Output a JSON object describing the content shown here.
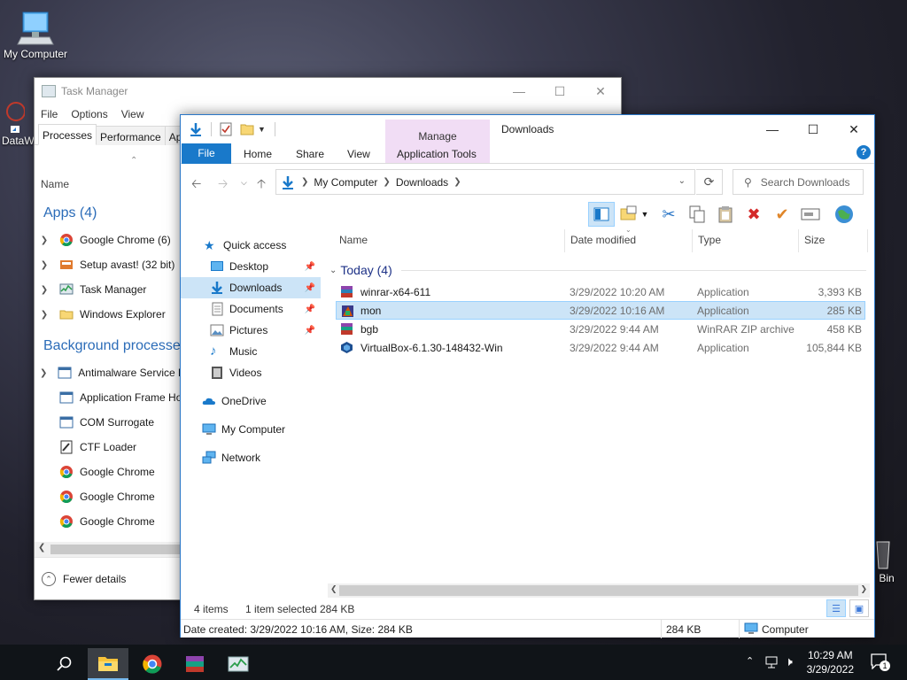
{
  "desktop": {
    "icons": [
      {
        "label": "My Computer"
      },
      {
        "label": "DataW"
      },
      {
        "label": "Bin"
      }
    ]
  },
  "task_manager": {
    "title": "Task Manager",
    "menu": [
      "File",
      "Options",
      "View"
    ],
    "tabs": [
      "Processes",
      "Performance",
      "Ap"
    ],
    "column_name": "Name",
    "apps_section": "Apps (4)",
    "apps": [
      {
        "label": "Google Chrome (6)",
        "icon": "chrome-icon"
      },
      {
        "label": "Setup avast! (32 bit)",
        "icon": "setup-icon"
      },
      {
        "label": "Task Manager",
        "icon": "task-manager-icon"
      },
      {
        "label": "Windows Explorer",
        "icon": "folder-icon"
      }
    ],
    "background_section": "Background processes",
    "background": [
      {
        "label": "Antimalware Service E",
        "icon": "service-icon",
        "expandable": true
      },
      {
        "label": "Application Frame Ho",
        "icon": "service-icon",
        "expandable": false
      },
      {
        "label": "COM Surrogate",
        "icon": "service-icon",
        "expandable": false
      },
      {
        "label": "CTF Loader",
        "icon": "ctf-icon",
        "expandable": false
      },
      {
        "label": "Google Chrome",
        "icon": "chrome-icon",
        "expandable": false
      },
      {
        "label": "Google Chrome",
        "icon": "chrome-icon",
        "expandable": false
      },
      {
        "label": "Google Chrome",
        "icon": "chrome-icon",
        "expandable": false
      }
    ],
    "fewer_details": "Fewer details"
  },
  "explorer": {
    "title": "Downloads",
    "manage_tab": "Manage",
    "ribbon_tabs": {
      "file": "File",
      "home": "Home",
      "share": "Share",
      "view": "View",
      "app_tools": "Application Tools"
    },
    "address": [
      "My Computer",
      "Downloads"
    ],
    "search_placeholder": "Search Downloads",
    "nav": [
      {
        "label": "Quick access",
        "pinned": false,
        "selected": false
      },
      {
        "label": "Desktop",
        "pinned": true,
        "selected": false
      },
      {
        "label": "Downloads",
        "pinned": true,
        "selected": true
      },
      {
        "label": "Documents",
        "pinned": true,
        "selected": false
      },
      {
        "label": "Pictures",
        "pinned": true,
        "selected": false
      },
      {
        "label": "Music",
        "pinned": false,
        "selected": false
      },
      {
        "label": "Videos",
        "pinned": false,
        "selected": false
      },
      {
        "label": "OneDrive",
        "pinned": false,
        "selected": false
      },
      {
        "label": "My Computer",
        "pinned": false,
        "selected": false
      },
      {
        "label": "Network",
        "pinned": false,
        "selected": false
      }
    ],
    "columns": {
      "name": "Name",
      "date": "Date modified",
      "type": "Type",
      "size": "Size"
    },
    "group_label": "Today (4)",
    "files": [
      {
        "name": "winrar-x64-611",
        "date": "3/29/2022 10:20 AM",
        "type": "Application",
        "size": "3,393 KB",
        "selected": false
      },
      {
        "name": "mon",
        "date": "3/29/2022 10:16 AM",
        "type": "Application",
        "size": "285 KB",
        "selected": true
      },
      {
        "name": "bgb",
        "date": "3/29/2022 9:44 AM",
        "type": "WinRAR ZIP archive",
        "size": "458 KB",
        "selected": false
      },
      {
        "name": "VirtualBox-6.1.30-148432-Win",
        "date": "3/29/2022 9:44 AM",
        "type": "Application",
        "size": "105,844 KB",
        "selected": false
      }
    ],
    "status": {
      "items": "4 items",
      "selected": "1 item selected",
      "selected_size": "284 KB"
    },
    "details": {
      "created": "Date created: 3/29/2022 10:16 AM, Size: 284 KB",
      "size": "284 KB",
      "location": "Computer"
    }
  },
  "taskbar": {
    "time": "10:29 AM",
    "date": "3/29/2022",
    "notifications": "1"
  }
}
